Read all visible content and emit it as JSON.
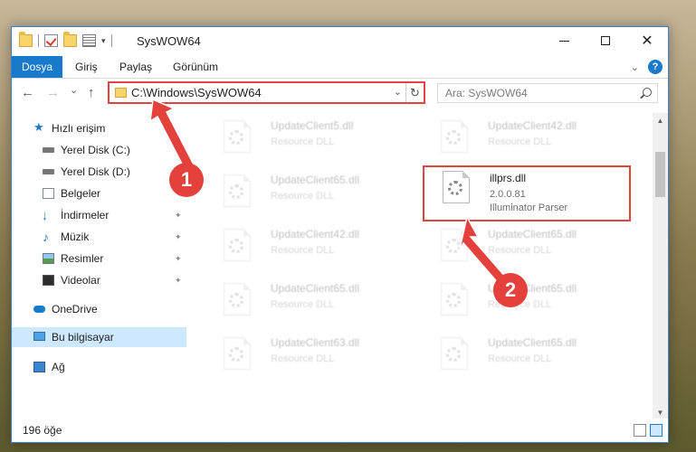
{
  "window": {
    "title": "SysWOW64",
    "controls": {
      "minimize": "",
      "maximize": "",
      "close": "✕"
    }
  },
  "ribbon": {
    "tabs": [
      "Dosya",
      "Giriş",
      "Paylaş",
      "Görünüm"
    ],
    "help": "?"
  },
  "navbar": {
    "back": "←",
    "forward": "→",
    "recent": "⌄",
    "up": "↑",
    "address": "C:\\Windows\\SysWOW64",
    "refresh": "↻",
    "search_placeholder": "Ara: SysWOW64"
  },
  "sidebar": {
    "items": [
      {
        "label": "Hızlı erişim",
        "icon": "star-icon"
      },
      {
        "label": "Yerel Disk (C:)",
        "icon": "disk-icon"
      },
      {
        "label": "Yerel Disk (D:)",
        "icon": "disk-icon"
      },
      {
        "label": "Belgeler",
        "icon": "document-icon"
      },
      {
        "label": "İndirmeler",
        "icon": "download-icon"
      },
      {
        "label": "Müzik",
        "icon": "music-icon"
      },
      {
        "label": "Resimler",
        "icon": "pictures-icon"
      },
      {
        "label": "Videolar",
        "icon": "videos-icon"
      },
      {
        "label": "OneDrive",
        "icon": "cloud-icon"
      },
      {
        "label": "Bu bilgisayar",
        "icon": "computer-icon"
      },
      {
        "label": "Ağ",
        "icon": "network-icon"
      }
    ],
    "pin": "📌"
  },
  "files": {
    "left": [
      {
        "name": "UpdateClient5.dll",
        "desc": "Resource DLL"
      },
      {
        "name": "UpdateClient65.dll",
        "desc": "Resource DLL"
      },
      {
        "name": "UpdateClient42.dll",
        "desc": "Resource DLL"
      },
      {
        "name": "UpdateClient65.dll",
        "desc": "Resource DLL"
      },
      {
        "name": "UpdateClient63.dll",
        "desc": "Resource DLL"
      }
    ],
    "right": [
      {
        "name": "UpdateClient42.dll",
        "desc": "Resource DLL"
      },
      {
        "name": "UpdateClient65.dll",
        "desc": "Resource DLL"
      },
      {
        "name": "UpdateClient65.dll",
        "desc": "Resource DLL"
      },
      {
        "name": "UpdateClient65.dll",
        "desc": "Resource DLL"
      }
    ],
    "highlighted": {
      "name": "illprs.dll",
      "version": "2.0.0.81",
      "desc": "Illuminator Parser"
    }
  },
  "status": {
    "count": "196 öğe"
  },
  "annotations": {
    "step1": "1",
    "step2": "2"
  }
}
